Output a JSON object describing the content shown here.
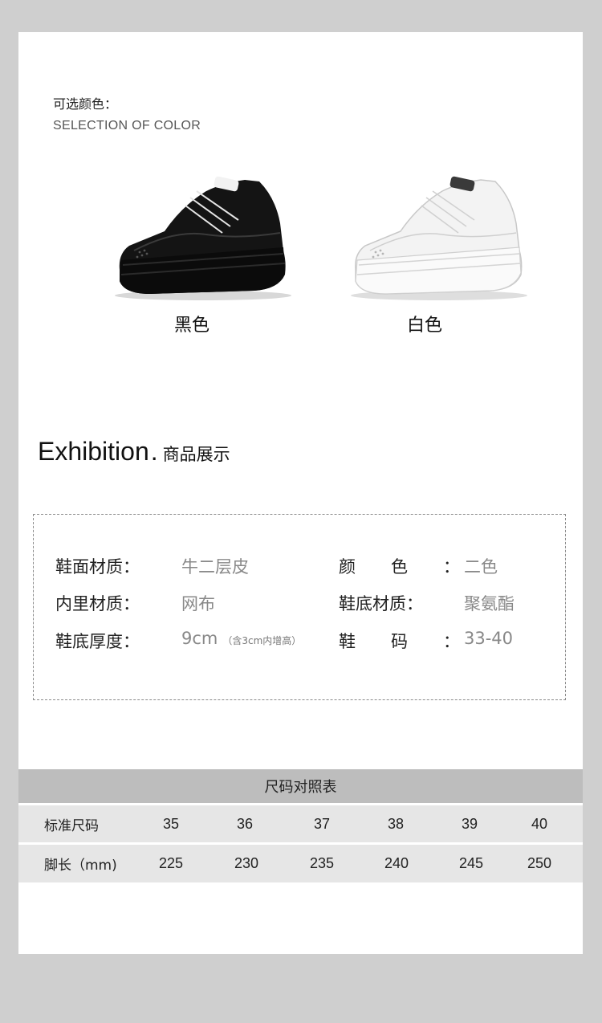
{
  "color_section": {
    "title_cn": "可选颜色：",
    "title_en": "SELECTION OF COLOR",
    "options": [
      {
        "label": "黑色",
        "swatch": "#111111"
      },
      {
        "label": "白色",
        "swatch": "#f4f4f4"
      }
    ]
  },
  "exhibition": {
    "title_en": "Exhibition",
    "dot": ".",
    "title_cn": "商品展示"
  },
  "specs": {
    "upper_material_label": "鞋面材质：",
    "upper_material_value": "牛二层皮",
    "color_label": "颜色：",
    "color_value": "二色",
    "lining_label": "内里材质：",
    "lining_value": "网布",
    "sole_material_label": "鞋底材质：",
    "sole_material_value": "聚氨酯",
    "sole_thickness_label": "鞋底厚度：",
    "sole_thickness_value": "9cm",
    "sole_thickness_note": "（含3cm内增高）",
    "size_label": "鞋码：",
    "size_value": "33-40"
  },
  "size_chart": {
    "title": "尺码对照表",
    "rows": [
      {
        "label": "标准尺码",
        "values": [
          "35",
          "36",
          "37",
          "38",
          "39",
          "40"
        ]
      },
      {
        "label": "脚长（mm)",
        "values": [
          "225",
          "230",
          "235",
          "240",
          "245",
          "250"
        ]
      }
    ]
  }
}
